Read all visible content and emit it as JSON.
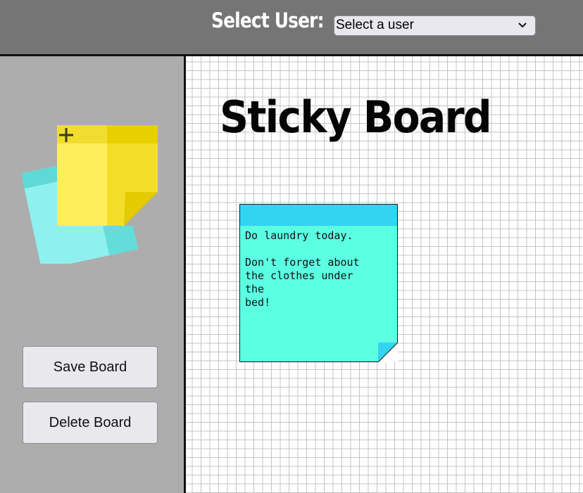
{
  "header": {
    "select_label": "Select User:",
    "user_select": {
      "selected": "Select a user"
    }
  },
  "sidebar": {
    "logo_icon": "sticky-notes-add-icon",
    "save_label": "Save Board",
    "delete_label": "Delete Board"
  },
  "board": {
    "title": "Sticky Board",
    "notes": [
      {
        "text": "Do laundry today.\n\nDon't forget about\nthe clothes under\nthe\nbed!",
        "color": "#5cffe2",
        "header_color": "#33d4f2"
      }
    ]
  },
  "colors": {
    "topbar": "#757575",
    "sidebar": "#adadad",
    "note_body": "#5cffe2",
    "note_header": "#33d4f2",
    "logo_yellow": "#ffee5c",
    "logo_cyan": "#8ff1ef"
  }
}
